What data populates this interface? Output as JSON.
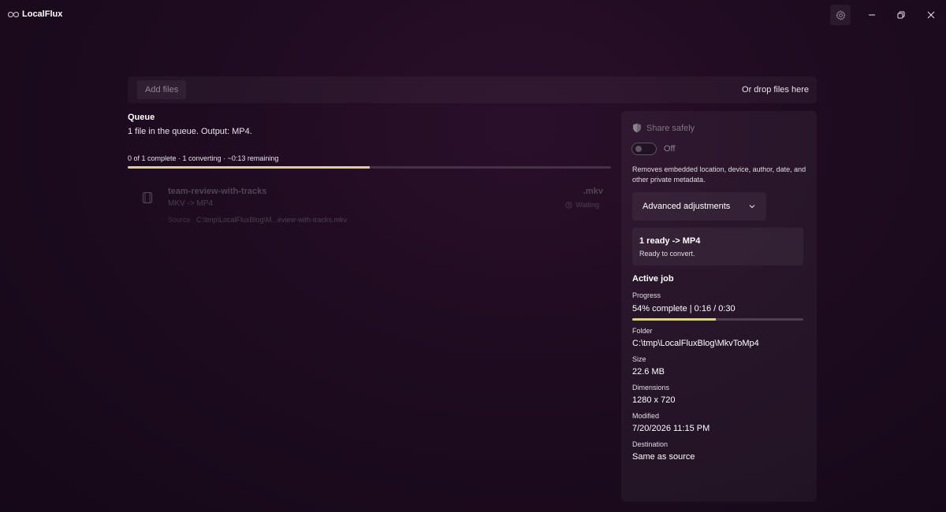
{
  "app": {
    "title": "LocalFlux",
    "logo_icon": "infinity-logo-icon",
    "accent_color": "#ddd08a"
  },
  "window_controls": {
    "settings_icon": "gear-icon",
    "minimize_icon": "minimize-icon",
    "maximize_icon": "restore-icon",
    "close_icon": "close-icon"
  },
  "dropbar": {
    "add_files_label": "Add files",
    "drop_hint": "Or drop files here"
  },
  "queue": {
    "title": "Queue",
    "summary": "1 file in the queue. Output: MP4.",
    "status": "0 of 1 complete · 1 converting · ~0:13 remaining",
    "progress_fraction": 0.5,
    "items": [
      {
        "name": "team-review-with-tracks",
        "extension": ".mkv",
        "conversion": "MKV -> MP4",
        "state": "Waiting",
        "source_label": "Source",
        "source_path": "C:\\tmp\\LocalFluxBlog\\M...eview-with-tracks.mkv"
      }
    ]
  },
  "side": {
    "share_title": "Share safely",
    "share_icon": "shield-icon",
    "toggle_state": "Off",
    "share_description": "Removes embedded location, device, author, date, and other private metadata.",
    "advanced_label": "Advanced adjustments",
    "ready_title": "1 ready -> MP4",
    "ready_subtitle": "Ready to convert.",
    "active_job_title": "Active job",
    "progress_label": "Progress",
    "progress_value": "54% complete | 0:16 / 0:30",
    "progress_fraction": 0.49,
    "folder_label": "Folder",
    "folder_value": "C:\\tmp\\LocalFluxBlog\\MkvToMp4",
    "size_label": "Size",
    "size_value": "22.6 MB",
    "dimensions_label": "Dimensions",
    "dimensions_value": "1280 x 720",
    "modified_label": "Modified",
    "modified_value": "7/20/2026 11:15 PM",
    "destination_label": "Destination",
    "destination_value": "Same as source"
  }
}
